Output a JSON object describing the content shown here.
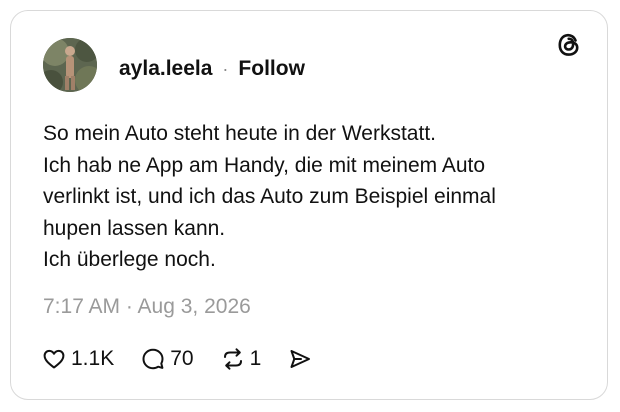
{
  "post": {
    "username": "ayla.leela",
    "separator": "·",
    "follow_label": "Follow",
    "text_lines": [
      "So mein Auto steht heute in der Werkstatt.",
      "Ich hab ne App am Handy, die mit meinem Auto",
      "verlinkt ist, und ich das Auto zum Beispiel einmal",
      "hupen lassen kann.",
      "Ich überlege noch."
    ],
    "timestamp": "7:17 AM · Aug 3, 2026"
  },
  "actions": {
    "likes": "1.1K",
    "replies": "70",
    "reposts": "1"
  },
  "icons": {
    "logo": "threads-logo-icon",
    "like": "heart-icon",
    "reply": "comment-bubble-icon",
    "repost": "repost-arrows-icon",
    "share": "send-icon"
  },
  "colors": {
    "text": "#111111",
    "muted": "#9a9a9a",
    "border": "#d9d9d9"
  }
}
